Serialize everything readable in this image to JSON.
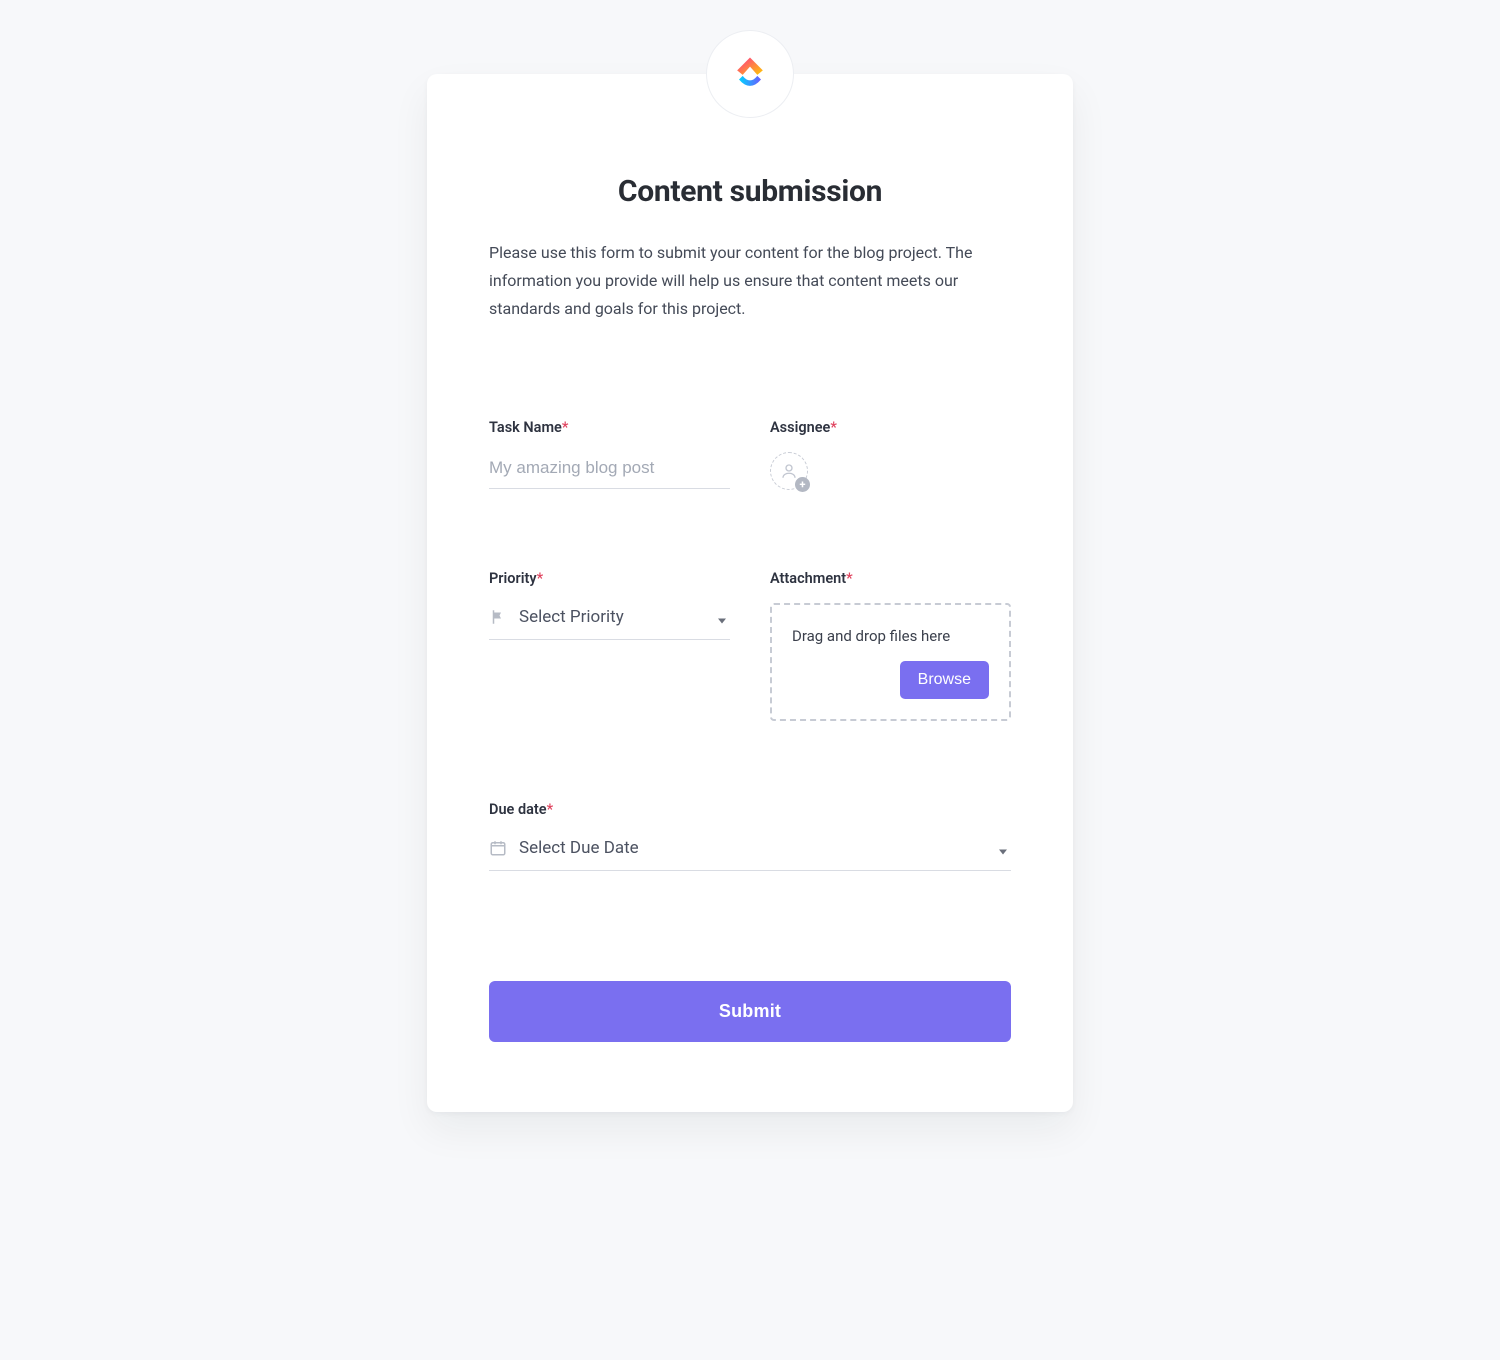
{
  "header": {
    "title": "Content submission",
    "description": "Please use this form to submit your content for the blog project. The information you provide will help us ensure that content meets our standards and goals for this project."
  },
  "fields": {
    "task_name": {
      "label": "Task Name",
      "required": "*",
      "placeholder": "My amazing blog post",
      "value": ""
    },
    "assignee": {
      "label": "Assignee",
      "required": "*"
    },
    "priority": {
      "label": "Priority",
      "required": "*",
      "placeholder": "Select Priority"
    },
    "attachment": {
      "label": "Attachment",
      "required": "*",
      "dropzone_text": "Drag and drop files here",
      "browse_label": "Browse"
    },
    "due_date": {
      "label": "Due date",
      "required": "*",
      "placeholder": "Select Due Date"
    }
  },
  "actions": {
    "submit_label": "Submit"
  }
}
